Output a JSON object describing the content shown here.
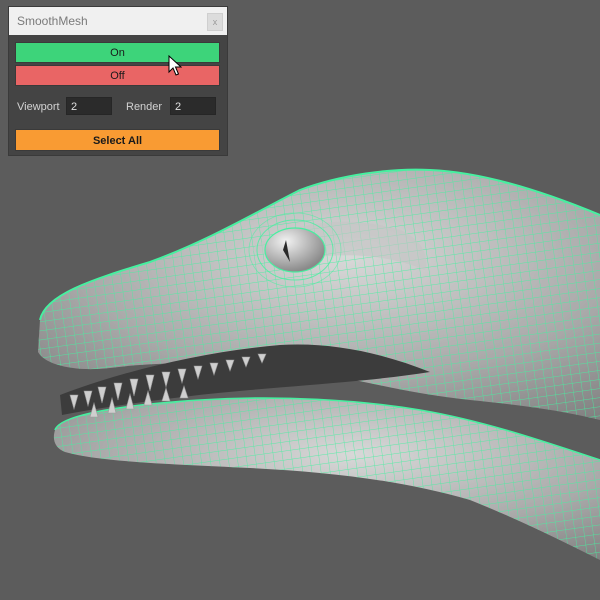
{
  "window": {
    "title": "SmoothMesh",
    "close_glyph": "x"
  },
  "buttons": {
    "on_label": "On",
    "off_label": "Off",
    "select_all_label": "Select All"
  },
  "levels": {
    "viewport_label": "Viewport",
    "viewport_value": "2",
    "render_label": "Render",
    "render_value": "2"
  },
  "colors": {
    "on": "#3dd47a",
    "off": "#e96565",
    "select_all": "#f99b33",
    "wireframe": "#46f0a0",
    "viewport_bg": "#5c5c5c"
  },
  "scene": {
    "object": "dinosaur-head-mesh",
    "display": "smooth-shaded-with-wireframe"
  }
}
